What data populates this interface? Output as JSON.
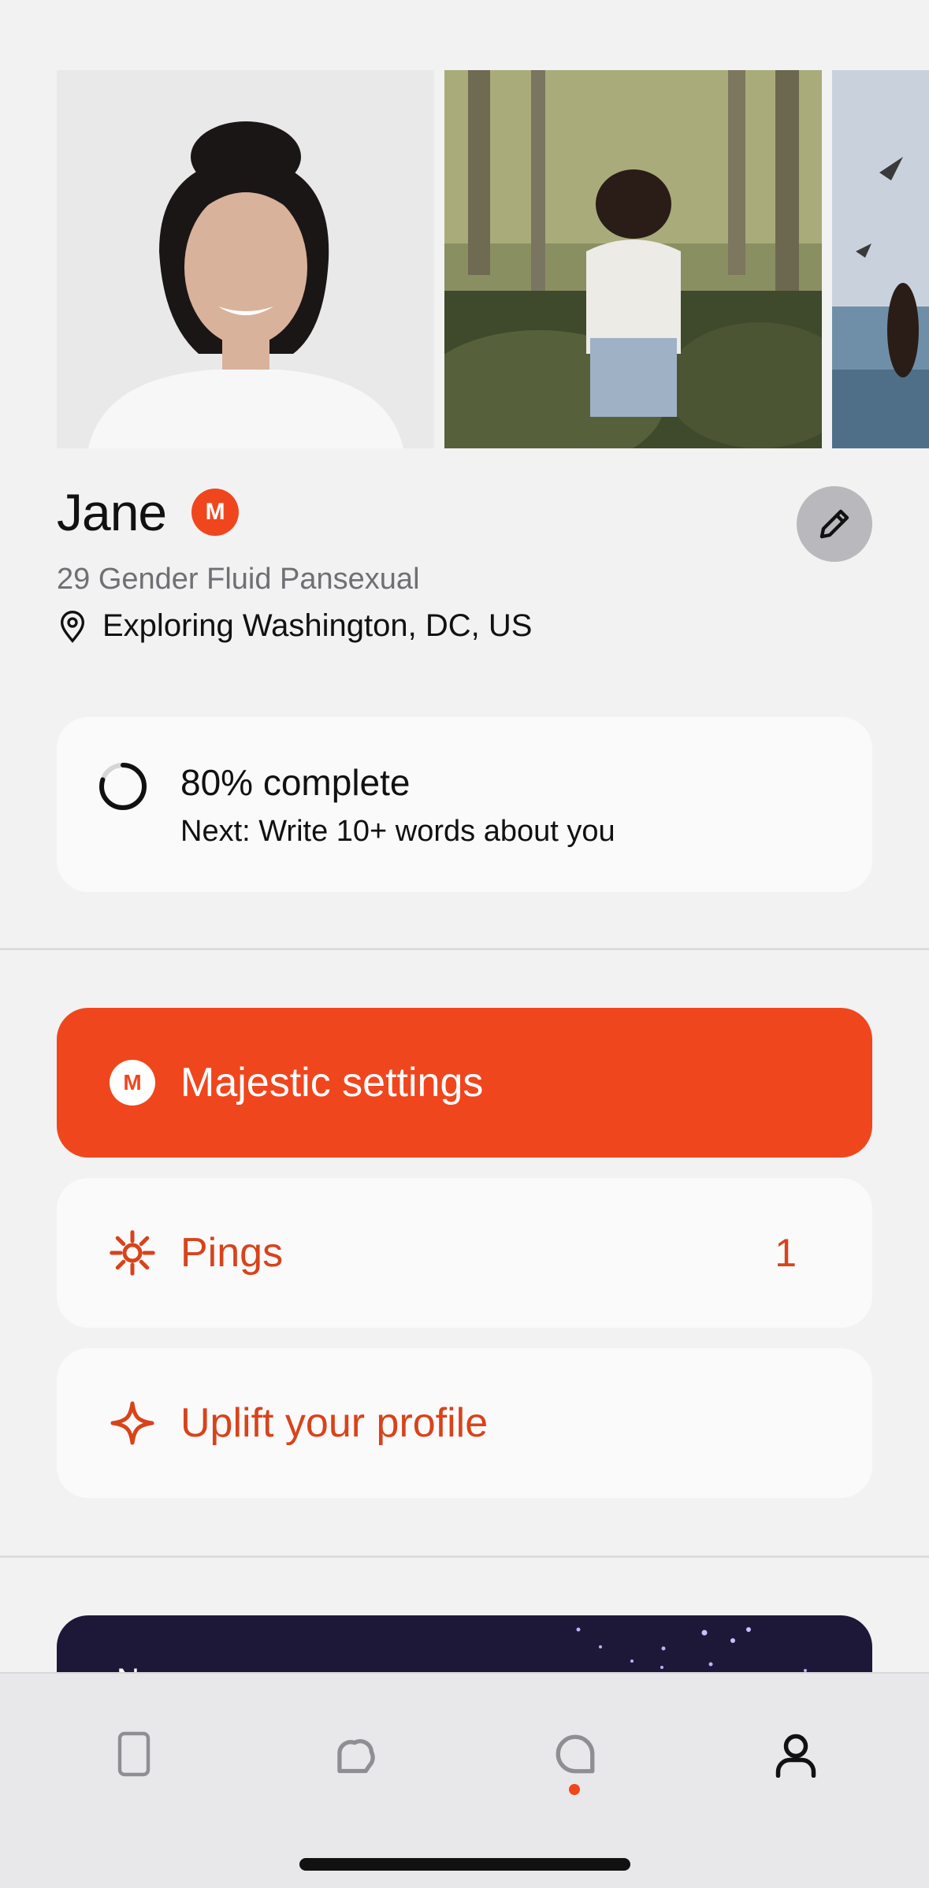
{
  "profile": {
    "name": "Jane",
    "badge_letter": "M",
    "identity": "29 Gender Fluid Pansexual",
    "location": "Exploring Washington, DC, US",
    "photos": [
      "portrait-photo",
      "field-photo",
      "beach-photo"
    ]
  },
  "completion": {
    "title": "80% complete",
    "next": "Next: Write 10+ words about you",
    "progress": 0.8
  },
  "actions": {
    "majestic": {
      "label": "Majestic settings",
      "badge_letter": "M"
    },
    "pings": {
      "label": "Pings",
      "count": "1"
    },
    "uplift": {
      "label": "Uplift your profile"
    }
  },
  "promo": {
    "text": "N"
  },
  "nav": {
    "items": [
      "cards-icon",
      "likes-icon",
      "chat-icon",
      "profile-icon"
    ],
    "active": "profile-icon"
  },
  "colors": {
    "accent": "#f0461e",
    "accent_text": "#d8431b",
    "background": "#f2f2f3",
    "card": "#fafafa",
    "promo_bg": "#1e1838"
  }
}
